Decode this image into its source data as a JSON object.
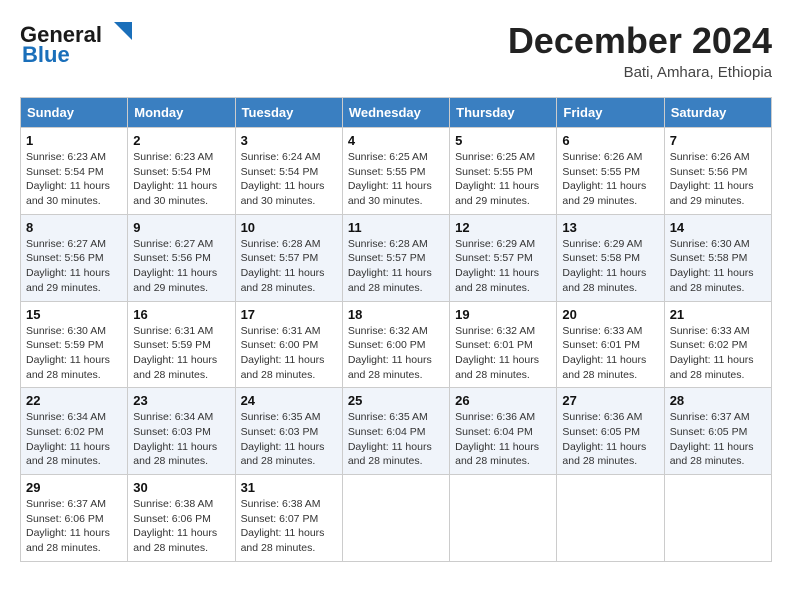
{
  "header": {
    "logo_line1": "General",
    "logo_line2": "Blue",
    "month": "December 2024",
    "location": "Bati, Amhara, Ethiopia"
  },
  "weekdays": [
    "Sunday",
    "Monday",
    "Tuesday",
    "Wednesday",
    "Thursday",
    "Friday",
    "Saturday"
  ],
  "weeks": [
    [
      {
        "day": 1,
        "sunrise": "6:23 AM",
        "sunset": "5:54 PM",
        "daylight": "11 hours and 30 minutes."
      },
      {
        "day": 2,
        "sunrise": "6:23 AM",
        "sunset": "5:54 PM",
        "daylight": "11 hours and 30 minutes."
      },
      {
        "day": 3,
        "sunrise": "6:24 AM",
        "sunset": "5:54 PM",
        "daylight": "11 hours and 30 minutes."
      },
      {
        "day": 4,
        "sunrise": "6:25 AM",
        "sunset": "5:55 PM",
        "daylight": "11 hours and 30 minutes."
      },
      {
        "day": 5,
        "sunrise": "6:25 AM",
        "sunset": "5:55 PM",
        "daylight": "11 hours and 29 minutes."
      },
      {
        "day": 6,
        "sunrise": "6:26 AM",
        "sunset": "5:55 PM",
        "daylight": "11 hours and 29 minutes."
      },
      {
        "day": 7,
        "sunrise": "6:26 AM",
        "sunset": "5:56 PM",
        "daylight": "11 hours and 29 minutes."
      }
    ],
    [
      {
        "day": 8,
        "sunrise": "6:27 AM",
        "sunset": "5:56 PM",
        "daylight": "11 hours and 29 minutes."
      },
      {
        "day": 9,
        "sunrise": "6:27 AM",
        "sunset": "5:56 PM",
        "daylight": "11 hours and 29 minutes."
      },
      {
        "day": 10,
        "sunrise": "6:28 AM",
        "sunset": "5:57 PM",
        "daylight": "11 hours and 28 minutes."
      },
      {
        "day": 11,
        "sunrise": "6:28 AM",
        "sunset": "5:57 PM",
        "daylight": "11 hours and 28 minutes."
      },
      {
        "day": 12,
        "sunrise": "6:29 AM",
        "sunset": "5:57 PM",
        "daylight": "11 hours and 28 minutes."
      },
      {
        "day": 13,
        "sunrise": "6:29 AM",
        "sunset": "5:58 PM",
        "daylight": "11 hours and 28 minutes."
      },
      {
        "day": 14,
        "sunrise": "6:30 AM",
        "sunset": "5:58 PM",
        "daylight": "11 hours and 28 minutes."
      }
    ],
    [
      {
        "day": 15,
        "sunrise": "6:30 AM",
        "sunset": "5:59 PM",
        "daylight": "11 hours and 28 minutes."
      },
      {
        "day": 16,
        "sunrise": "6:31 AM",
        "sunset": "5:59 PM",
        "daylight": "11 hours and 28 minutes."
      },
      {
        "day": 17,
        "sunrise": "6:31 AM",
        "sunset": "6:00 PM",
        "daylight": "11 hours and 28 minutes."
      },
      {
        "day": 18,
        "sunrise": "6:32 AM",
        "sunset": "6:00 PM",
        "daylight": "11 hours and 28 minutes."
      },
      {
        "day": 19,
        "sunrise": "6:32 AM",
        "sunset": "6:01 PM",
        "daylight": "11 hours and 28 minutes."
      },
      {
        "day": 20,
        "sunrise": "6:33 AM",
        "sunset": "6:01 PM",
        "daylight": "11 hours and 28 minutes."
      },
      {
        "day": 21,
        "sunrise": "6:33 AM",
        "sunset": "6:02 PM",
        "daylight": "11 hours and 28 minutes."
      }
    ],
    [
      {
        "day": 22,
        "sunrise": "6:34 AM",
        "sunset": "6:02 PM",
        "daylight": "11 hours and 28 minutes."
      },
      {
        "day": 23,
        "sunrise": "6:34 AM",
        "sunset": "6:03 PM",
        "daylight": "11 hours and 28 minutes."
      },
      {
        "day": 24,
        "sunrise": "6:35 AM",
        "sunset": "6:03 PM",
        "daylight": "11 hours and 28 minutes."
      },
      {
        "day": 25,
        "sunrise": "6:35 AM",
        "sunset": "6:04 PM",
        "daylight": "11 hours and 28 minutes."
      },
      {
        "day": 26,
        "sunrise": "6:36 AM",
        "sunset": "6:04 PM",
        "daylight": "11 hours and 28 minutes."
      },
      {
        "day": 27,
        "sunrise": "6:36 AM",
        "sunset": "6:05 PM",
        "daylight": "11 hours and 28 minutes."
      },
      {
        "day": 28,
        "sunrise": "6:37 AM",
        "sunset": "6:05 PM",
        "daylight": "11 hours and 28 minutes."
      }
    ],
    [
      {
        "day": 29,
        "sunrise": "6:37 AM",
        "sunset": "6:06 PM",
        "daylight": "11 hours and 28 minutes."
      },
      {
        "day": 30,
        "sunrise": "6:38 AM",
        "sunset": "6:06 PM",
        "daylight": "11 hours and 28 minutes."
      },
      {
        "day": 31,
        "sunrise": "6:38 AM",
        "sunset": "6:07 PM",
        "daylight": "11 hours and 28 minutes."
      },
      null,
      null,
      null,
      null
    ]
  ]
}
